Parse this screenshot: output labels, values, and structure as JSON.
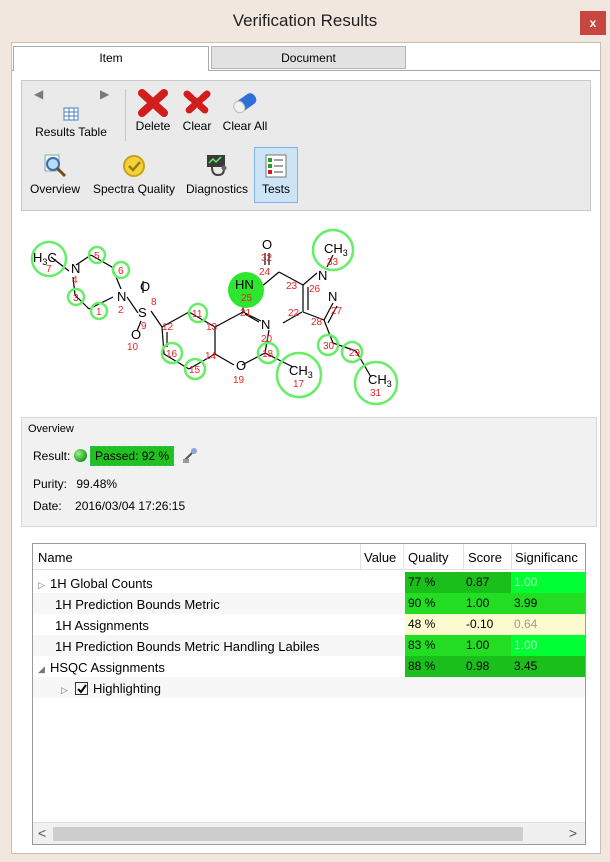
{
  "window": {
    "title": "Verification Results",
    "close_label": "x"
  },
  "tabs": [
    {
      "label": "Item"
    },
    {
      "label": "Document"
    }
  ],
  "toolbar": {
    "results_table": "Results Table",
    "delete": "Delete",
    "clear": "Clear",
    "clear_all": "Clear All",
    "overview": "Overview",
    "spectra_quality": "Spectra Quality",
    "diagnostics": "Diagnostics",
    "tests": "Tests"
  },
  "molecule": {
    "atoms": [
      {
        "label": "H3C",
        "num": "7"
      },
      {
        "label": "N",
        "num": "4"
      },
      {
        "label": "",
        "num": "5"
      },
      {
        "label": "",
        "num": "6"
      },
      {
        "label": "",
        "num": "3"
      },
      {
        "label": "",
        "num": "1"
      },
      {
        "label": "N",
        "num": "2"
      },
      {
        "label": "S",
        "num": "9"
      },
      {
        "label": "O",
        "num": "8"
      },
      {
        "label": "O",
        "num": "10"
      },
      {
        "label": "",
        "num": "11"
      },
      {
        "label": "",
        "num": "12"
      },
      {
        "label": "",
        "num": "13"
      },
      {
        "label": "",
        "num": "14"
      },
      {
        "label": "",
        "num": "15"
      },
      {
        "label": "",
        "num": "16"
      },
      {
        "label": "HN",
        "num": "25"
      },
      {
        "label": "",
        "num": "21"
      },
      {
        "label": "N",
        "num": "20"
      },
      {
        "label": "O",
        "num": "19"
      },
      {
        "label": "",
        "num": "18"
      },
      {
        "label": "CH3",
        "num": "17"
      },
      {
        "label": "O",
        "num": "32"
      },
      {
        "label": "",
        "num": "24"
      },
      {
        "label": "",
        "num": "23"
      },
      {
        "label": "",
        "num": "22"
      },
      {
        "label": "N",
        "num": "26"
      },
      {
        "label": "CH3",
        "num": "33"
      },
      {
        "label": "N",
        "num": "27"
      },
      {
        "label": "",
        "num": "28"
      },
      {
        "label": "",
        "num": "30"
      },
      {
        "label": "",
        "num": "29"
      },
      {
        "label": "CH3",
        "num": "31"
      }
    ]
  },
  "overview": {
    "title": "Overview",
    "result_label": "Result:",
    "result_value": "Passed: 92 %",
    "purity_label": "Purity:",
    "purity_value": "99.48%",
    "date_label": "Date:",
    "date_value": "2016/03/04 17:26:15"
  },
  "table": {
    "headers": {
      "name": "Name",
      "value": "Value",
      "quality": "Quality",
      "score": "Score",
      "significance": "Significanc"
    },
    "rows": [
      {
        "name": "1H Global Counts",
        "quality": "77 %",
        "score": "0.87",
        "significance": "1.00",
        "expander": "▷",
        "indent": 0
      },
      {
        "name": "1H Prediction Bounds Metric",
        "quality": "90 %",
        "score": "1.00",
        "significance": "3.99",
        "expander": "",
        "indent": 1
      },
      {
        "name": "1H Assignments",
        "quality": "48 %",
        "score": "-0.10",
        "significance": "0.64",
        "expander": "",
        "indent": 1
      },
      {
        "name": "1H Prediction Bounds Metric Handling Labiles",
        "quality": "83 %",
        "score": "1.00",
        "significance": "1.00",
        "expander": "",
        "indent": 1
      },
      {
        "name": "HSQC Assignments",
        "quality": "88 %",
        "score": "0.98",
        "significance": "3.45",
        "expander": "◢",
        "indent": 0
      },
      {
        "name": "Highlighting",
        "quality": "",
        "score": "",
        "significance": "",
        "expander": "▷",
        "indent": 2
      }
    ],
    "colors": {
      "bright": "#00ff33",
      "mid": "#22dd22",
      "dark": "#1bbf1b",
      "pale": "#fbfbcf"
    }
  },
  "scroll": {
    "left": "<",
    "right": ">"
  }
}
